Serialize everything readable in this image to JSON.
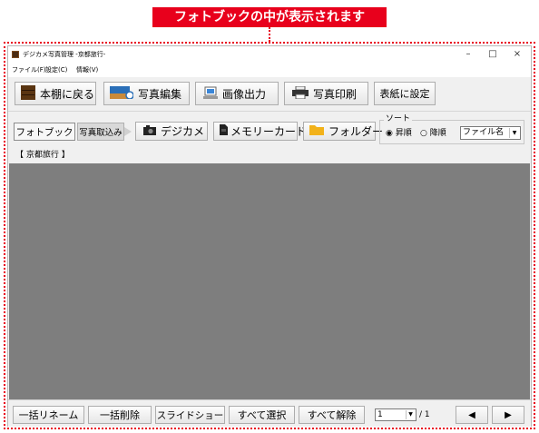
{
  "banner": {
    "text": "フォトブックの中が表示されます"
  },
  "window": {
    "title": "デジカメ写真管理 -京都旅行-",
    "controls": {
      "minimize": "–",
      "maximize": "□",
      "close": "×"
    }
  },
  "menu": {
    "items": [
      "ファイル(F)",
      "設定(C)",
      "情報(V)"
    ]
  },
  "toolbar": {
    "back": "本棚に戻る",
    "edit": "写真編集",
    "export": "画像出力",
    "print": "写真印刷",
    "cover": "表紙に設定"
  },
  "source_tabs": {
    "photobook": "フォトブック",
    "import": "写真取込み",
    "camera": "デジカメ",
    "memory_card": "メモリーカード",
    "folder": "フォルダー"
  },
  "sort": {
    "legend": "ソート",
    "ascending": "昇順",
    "descending": "降順",
    "selected_order": "ascending",
    "field": "ファイル名"
  },
  "album": {
    "label": "【 京都旅行 】"
  },
  "bottom": {
    "bulk_rename": "一括リネーム",
    "bulk_delete": "一括削除",
    "slideshow": "スライドショー",
    "select_all": "すべて選択",
    "deselect_all": "すべて解除",
    "page": "1",
    "total": "/ 1",
    "prev": "◀",
    "next": "▶"
  },
  "colors": {
    "accent": "#e8001c",
    "content_bg": "#7e7e7e"
  }
}
